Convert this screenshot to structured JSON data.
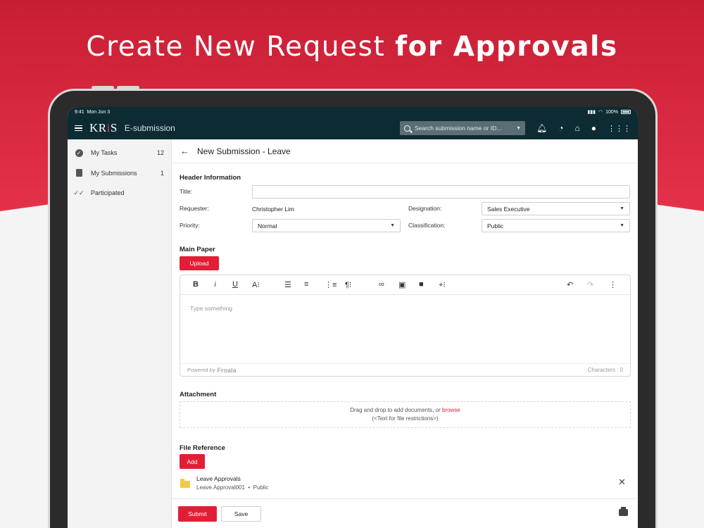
{
  "headline": {
    "light": "Create New Request ",
    "bold": "for Approvals"
  },
  "statusbar": {
    "time": "9:41",
    "date": "Mon Jun 3",
    "battery": "100%"
  },
  "navbar": {
    "logo_pre": "KR",
    "logo_mark": "i",
    "logo_post": "S",
    "app_name": "E-submission",
    "search_placeholder": "Search submission name or ID...",
    "icons": [
      "hamburger-icon",
      "search-icon",
      "bell-icon",
      "dashboard-icon",
      "home-icon",
      "account-icon",
      "apps-grid-icon"
    ]
  },
  "sidebar": {
    "items": [
      {
        "label": "My Tasks",
        "count": "12",
        "icon": "check-circle-icon"
      },
      {
        "label": "My Submissions",
        "count": "1",
        "icon": "document-icon"
      },
      {
        "label": "Participated",
        "count": "",
        "icon": "double-check-icon"
      }
    ]
  },
  "page": {
    "title": "New Submission - Leave"
  },
  "header_info": {
    "section_title": "Header Information",
    "title_label": "Title:",
    "title_value": "",
    "requester_label": "Requester:",
    "requester_value": "Christopher Lim",
    "designation_label": "Designation:",
    "designation_value": "Sales Executive",
    "priority_label": "Priority:",
    "priority_value": "Normal",
    "classification_label": "Classification:",
    "classification_value": "Public"
  },
  "main_paper": {
    "section_title": "Main Paper",
    "upload_label": "Upload",
    "editor_placeholder": "Type something",
    "powered_by": "Powered by",
    "froala": "Froala",
    "characters": "Characters : 0"
  },
  "attachment": {
    "section_title": "Attachment",
    "drop_text": "Drag and drop to add documents, or ",
    "browse": "browse",
    "restriction": "(<Text for file restrictions>)"
  },
  "file_reference": {
    "section_title": "File Reference",
    "add_label": "Add",
    "item_name": "Leave Approvals",
    "item_id": "Leave.Approval001",
    "item_class": "Public"
  },
  "actions": {
    "submit": "Submit",
    "save": "Save"
  },
  "colors": {
    "accent": "#e01f36",
    "navbar": "#0d2b33",
    "folder": "#f5c84b"
  }
}
